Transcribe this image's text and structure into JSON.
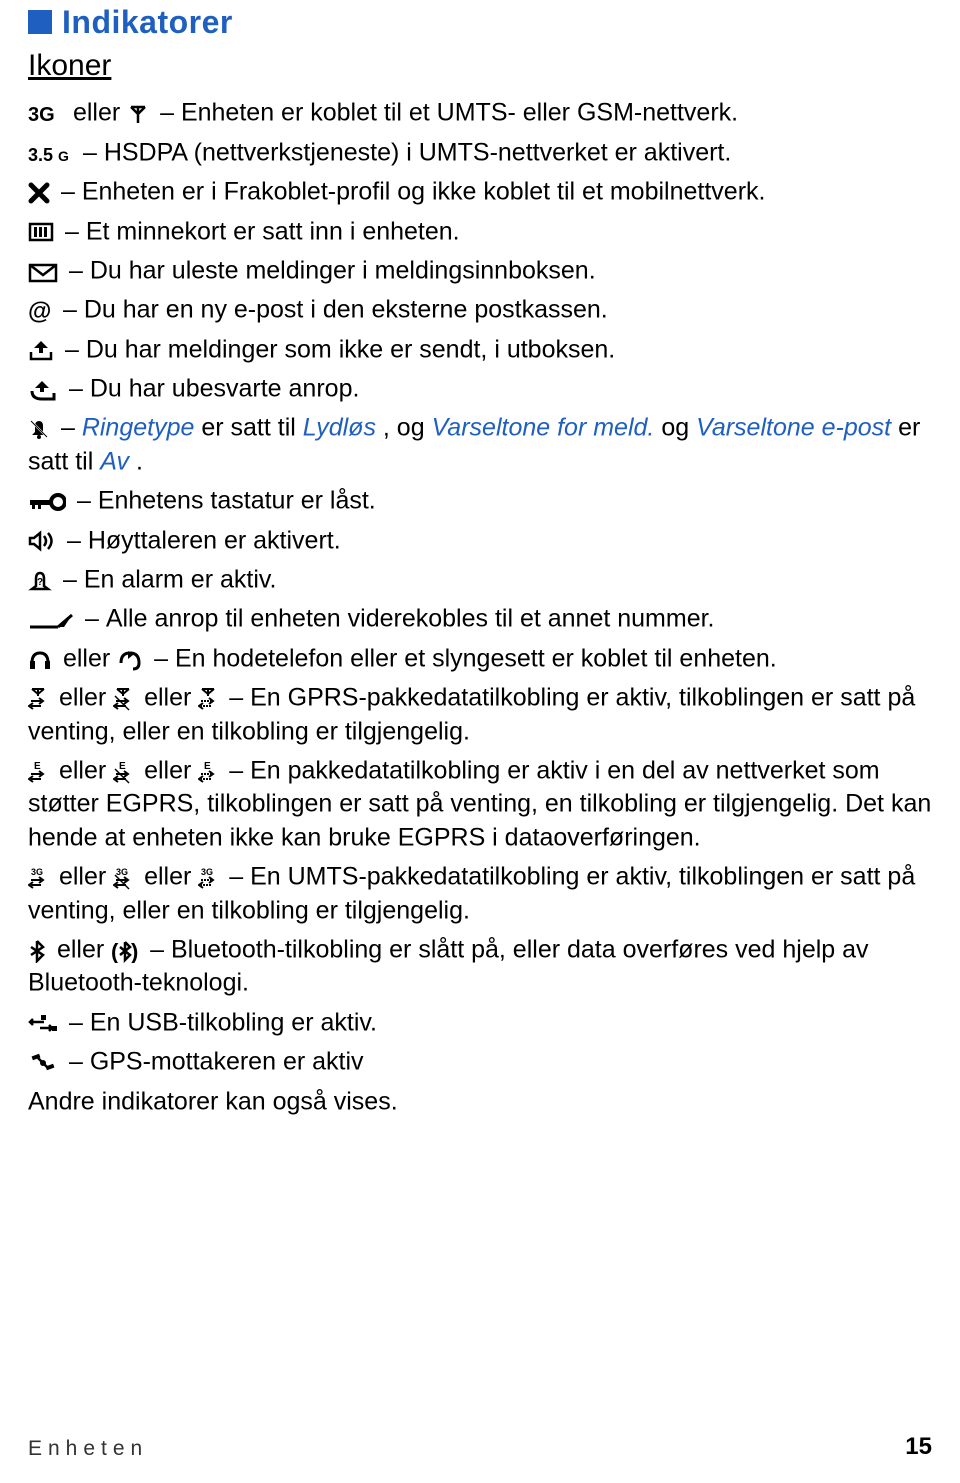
{
  "heading": "Indikatorer",
  "subheading": "Ikoner",
  "icons": {
    "3g": "3G",
    "antenna": "antenna",
    "35g": "3.5G",
    "x": "X",
    "memory": "M",
    "envelope": "✉",
    "at": "@",
    "outbox": "out",
    "missed": "missed",
    "silent": "silent",
    "keylock": "key",
    "speaker": "spk",
    "alarm": "alarm",
    "forward": "fwd",
    "headphones": "hp",
    "loopset": "loop",
    "gprs1": "g1",
    "gprs2": "g2",
    "gprs3": "g3",
    "e1": "e1",
    "e2": "e2",
    "e3": "e3",
    "u1": "u1",
    "u2": "u2",
    "u3": "u3",
    "bt": "bt",
    "btx": "btx",
    "usb": "usb",
    "gps": "gps"
  },
  "txt": {
    "eller": " eller ",
    "dash": " – ",
    "e1": "Enheten er koblet til et UMTS- eller GSM-nettverk.",
    "e2": "HSDPA (nettverkstjeneste) i UMTS-nettverket er aktivert.",
    "e3": "Enheten er i Frakoblet-profil og ikke koblet til et mobilnettverk.",
    "e4": "Et minnekort er satt inn i enheten.",
    "e5": "Du har uleste meldinger i meldingsinnboksen.",
    "e6": "Du har en ny e-post i den eksterne postkassen.",
    "e7": "Du har meldinger som ikke er sendt, i utboksen.",
    "e8": "Du har ubesvarte anrop.",
    "e9a": "Ringetype",
    "e9b": " er satt til ",
    "e9c": "Lydløs",
    "e9d": ", og ",
    "e9e": "Varseltone for meld.",
    "e9f": " og ",
    "e9g": "Varseltone e-post",
    "e9h": " er satt til ",
    "e9i": "Av",
    "e9j": ".",
    "e10": "Enhetens tastatur er låst.",
    "e11": "Høyttaleren er aktivert.",
    "e12": "En alarm er aktiv.",
    "e13": "Alle anrop til enheten viderekobles til et annet nummer.",
    "e14": "En hodetelefon eller et slyngesett er koblet til enheten.",
    "e15": "En GPRS-pakkedatatilkobling er aktiv, tilkoblingen er satt på venting, eller en tilkobling er tilgjengelig.",
    "e16": "En pakkedatatilkobling er aktiv i en del av nettverket som støtter EGPRS, tilkoblingen er satt på venting, en tilkobling er tilgjengelig. Det kan hende at enheten ikke kan bruke EGPRS i dataoverføringen.",
    "e17": "En UMTS-pakkedatatilkobling er aktiv, tilkoblingen er satt på venting, eller en tilkobling er tilgjengelig.",
    "e18": "Bluetooth-tilkobling er slått på, eller data overføres ved hjelp av Bluetooth-teknologi.",
    "e19": "En USB-tilkobling er aktiv.",
    "e20": "GPS-mottakeren er aktiv",
    "other": "Andre indikatorer kan også vises."
  },
  "footer": {
    "section": "Enheten",
    "page": "15"
  }
}
